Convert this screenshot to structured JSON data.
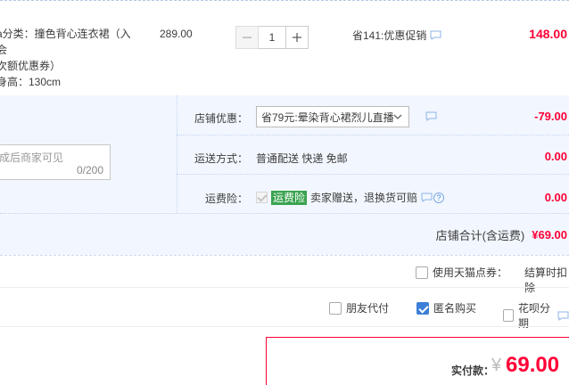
{
  "product": {
    "desc_line1": "a分类：撞色背心连衣裙（入会",
    "desc_line2": "次额优惠券）",
    "desc_line3": "身高：130cm",
    "unit_price": "289.00",
    "quantity": "1",
    "promo": "省141:优惠促销",
    "line_total": "148.00"
  },
  "memo": {
    "placeholder": "成后商家可见",
    "counter": "0/200"
  },
  "shop_discount": {
    "label": "店铺优惠：",
    "selected": "省79元:晕染背心裙烈儿直播",
    "amount": "-79.00"
  },
  "shipping": {
    "label": "运送方式：",
    "value": "普通配送 快递 免邮",
    "amount": "0.00"
  },
  "insurance": {
    "label": "运费险：",
    "tag": "运费险",
    "text": "卖家赠送，退换货可赔",
    "amount": "0.00"
  },
  "shop_total": {
    "label": "店铺合计(含运费)",
    "value": "¥69.00"
  },
  "points": {
    "label": "使用天猫点券：",
    "note": "结算时扣除"
  },
  "options": {
    "friend_pay": "朋友代付",
    "anonymous": "匿名购买",
    "huabei": "花呗分期"
  },
  "payment": {
    "label": "实付款：",
    "currency": "¥",
    "amount": "69.00"
  },
  "colors": {
    "accent_red": "#ff0036",
    "panel_bg": "#f2f7ff",
    "check_blue": "#3d7fd6",
    "tag_green": "#3aa34f"
  }
}
